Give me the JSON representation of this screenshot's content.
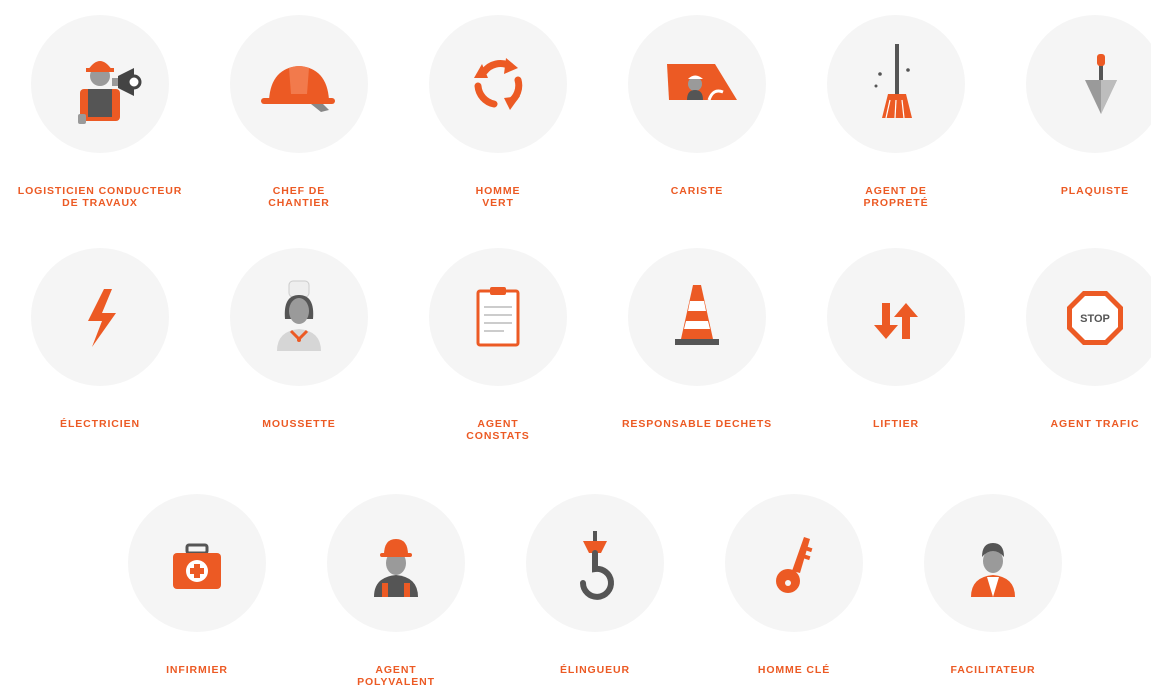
{
  "colors": {
    "accent": "#ec5a24",
    "grey": "#9a9a9a",
    "dark_grey": "#555555",
    "circle_bg": "#f5f5f5"
  },
  "jobs": [
    {
      "label": "LOGISTICIEN CONDUCTEUR\nDE TRAVAUX",
      "icon": "worker-megaphone-icon"
    },
    {
      "label": "CHEF DE\nCHANTIER",
      "icon": "hard-hat-icon"
    },
    {
      "label": "HOMME\nVERT",
      "icon": "recycle-arrows-icon"
    },
    {
      "label": "CARISTE",
      "icon": "forklift-driver-icon"
    },
    {
      "label": "AGENT DE\nPROPRETÉ",
      "icon": "broom-icon"
    },
    {
      "label": "PLAQUISTE",
      "icon": "trowel-icon"
    },
    {
      "label": "ÉLECTRICIEN",
      "icon": "lightning-bolt-icon"
    },
    {
      "label": "MOUSSETTE",
      "icon": "cook-icon"
    },
    {
      "label": "AGENT\nCONSTATS",
      "icon": "clipboard-icon"
    },
    {
      "label": "RESPONSABLE DECHETS",
      "icon": "traffic-cone-icon"
    },
    {
      "label": "LIFTIER",
      "icon": "up-down-arrows-icon"
    },
    {
      "label": "AGENT TRAFIC",
      "icon": "stop-sign-icon",
      "sign_text": "STOP"
    },
    {
      "label": "INFIRMIER",
      "icon": "first-aid-kit-icon"
    },
    {
      "label": "AGENT\nPOLYVALENT",
      "icon": "worker-helmet-icon"
    },
    {
      "label": "ÉLINGUEUR",
      "icon": "crane-hook-icon"
    },
    {
      "label": "HOMME CLÉ",
      "icon": "key-icon"
    },
    {
      "label": "FACILITATEUR",
      "icon": "facilitator-icon"
    }
  ]
}
